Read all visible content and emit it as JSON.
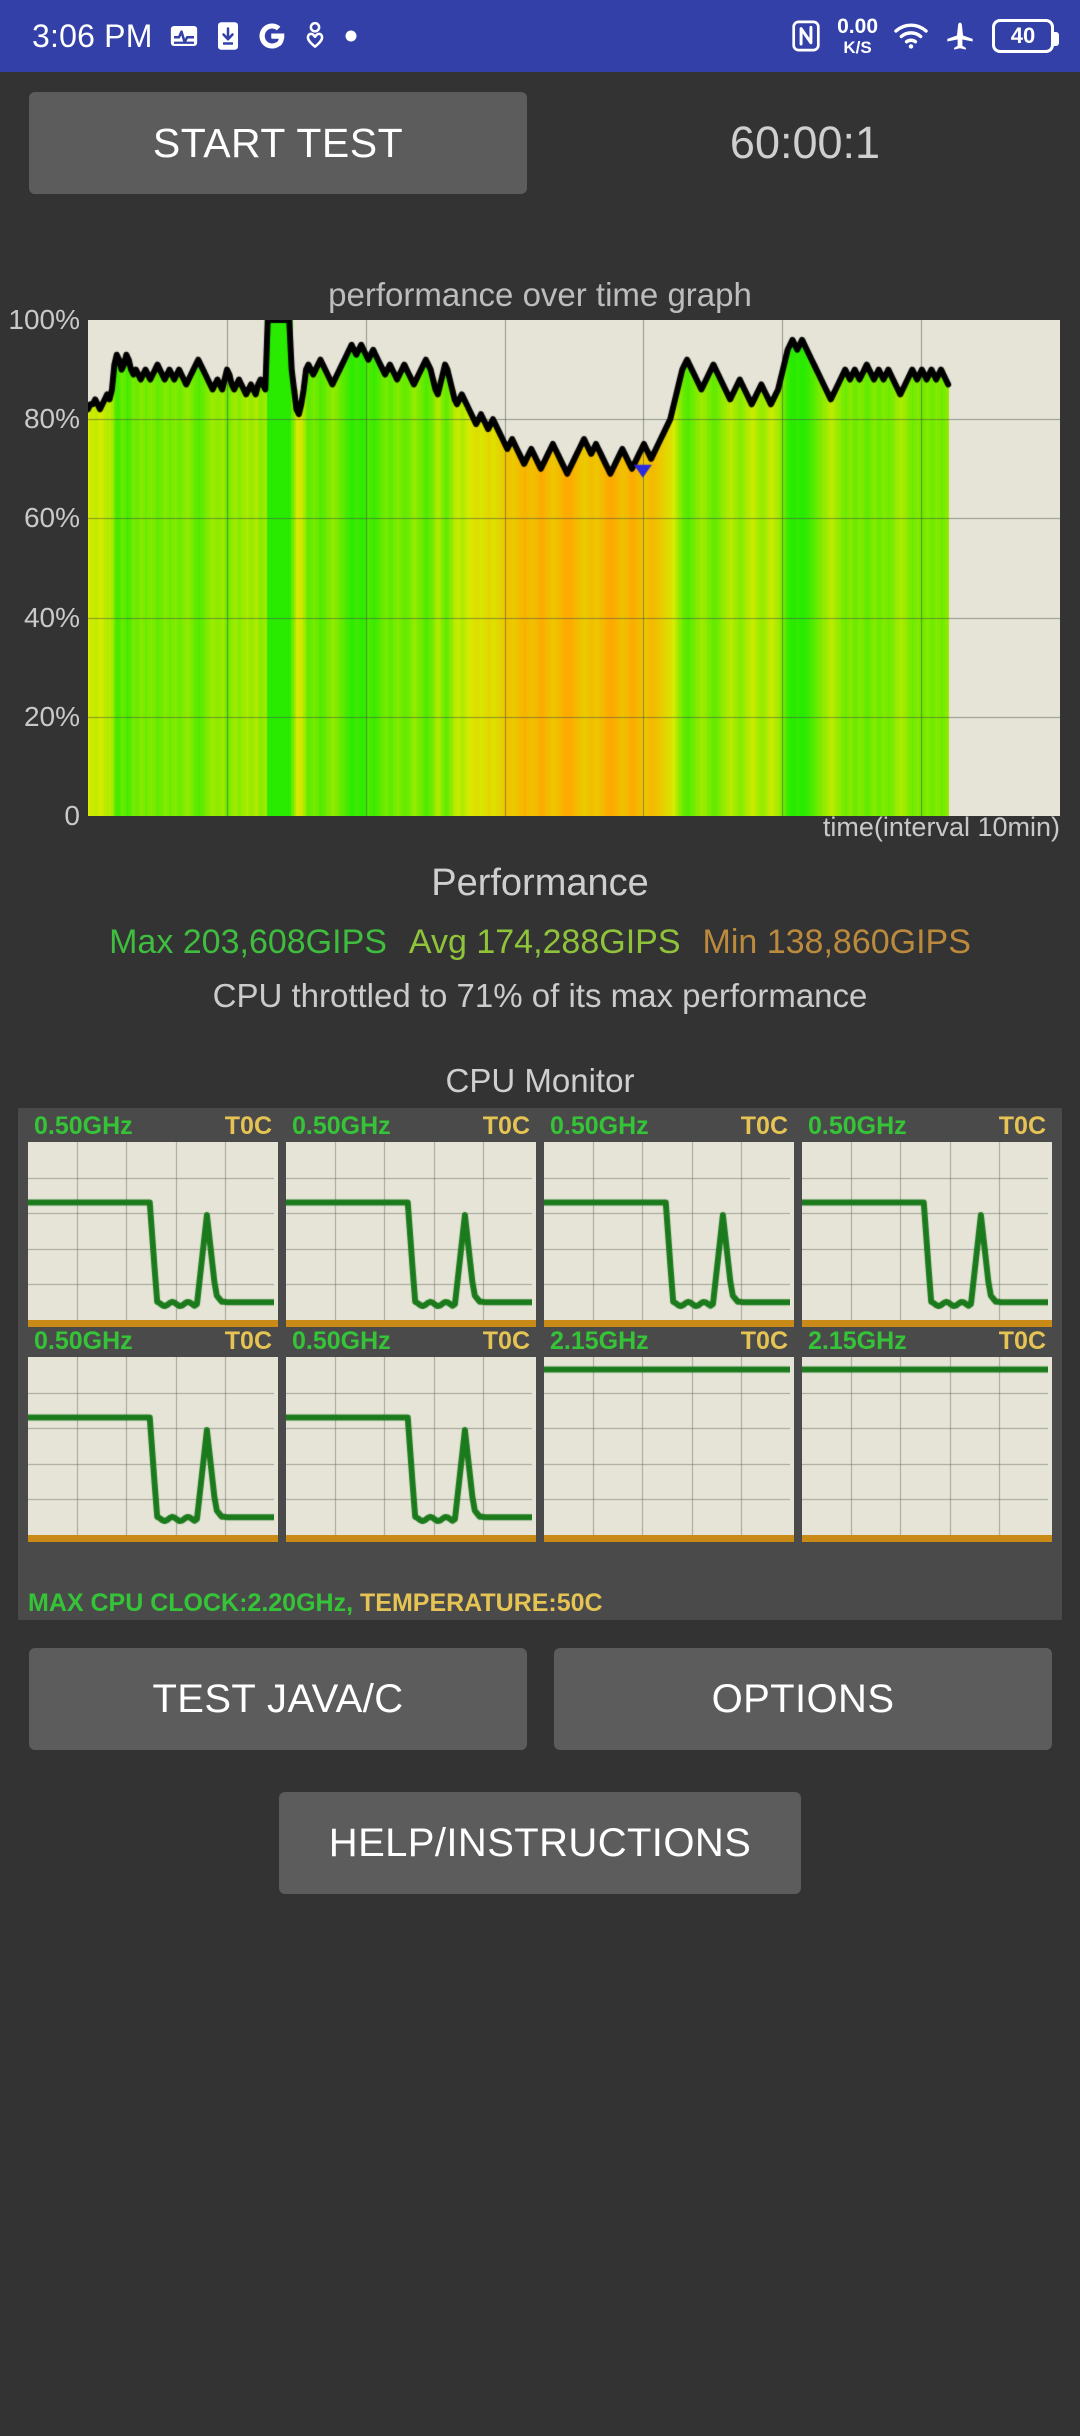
{
  "statusbar": {
    "time": "3:06 PM",
    "left_icons": [
      "activity-monitor-icon",
      "phone-download-icon",
      "google-icon",
      "person-heart-icon",
      "dot-icon"
    ],
    "network_speed_value": "0.00",
    "network_speed_unit": "K/S",
    "right_icons": [
      "nfc-icon",
      "network-speed-indicator",
      "wifi-icon",
      "airplane-mode-icon",
      "battery-icon"
    ],
    "battery_level": "40",
    "background_color": "#3340a8"
  },
  "toolbar": {
    "start_test_label": "START TEST",
    "timer": "60:00:1"
  },
  "chart_data": {
    "type": "area",
    "title": "performance over time graph",
    "xlabel": "time(interval 10min)",
    "ylabel": "",
    "ytick_labels": [
      "100%",
      "80%",
      "60%",
      "40%",
      "20%",
      "0"
    ],
    "ytick_values": [
      100,
      80,
      60,
      40,
      20,
      0
    ],
    "ylim": [
      0,
      100
    ],
    "grid": true,
    "plot_bg": "#e6e4d7",
    "line_color": "#000000",
    "xgridlines": 6,
    "data_fraction": 0.885,
    "values": [
      82,
      83,
      83,
      84,
      83,
      82,
      83,
      84,
      85,
      84,
      86,
      91,
      93,
      92,
      90,
      91,
      93,
      92,
      90,
      89,
      90,
      89,
      88,
      89,
      90,
      89,
      88,
      89,
      90,
      91,
      90,
      89,
      88,
      89,
      90,
      89,
      88,
      89,
      90,
      89,
      88,
      87,
      88,
      89,
      90,
      91,
      92,
      91,
      90,
      89,
      88,
      87,
      86,
      87,
      88,
      87,
      86,
      88,
      90,
      89,
      87,
      86,
      87,
      88,
      87,
      86,
      85,
      86,
      87,
      86,
      85,
      87,
      88,
      87,
      86,
      100,
      100,
      100,
      100,
      100,
      100,
      100,
      100,
      100,
      100,
      90,
      86,
      82,
      81,
      83,
      86,
      90,
      91,
      90,
      89,
      90,
      91,
      92,
      91,
      90,
      89,
      88,
      87,
      88,
      89,
      90,
      91,
      92,
      93,
      94,
      95,
      94,
      93,
      94,
      95,
      94,
      93,
      92,
      93,
      94,
      93,
      92,
      91,
      90,
      89,
      90,
      91,
      90,
      89,
      88,
      89,
      90,
      91,
      90,
      89,
      88,
      87,
      88,
      89,
      90,
      91,
      92,
      91,
      90,
      88,
      86,
      85,
      87,
      89,
      91,
      90,
      88,
      86,
      84,
      83,
      84,
      85,
      84,
      83,
      82,
      81,
      80,
      79,
      80,
      81,
      80,
      79,
      78,
      79,
      80,
      79,
      78,
      77,
      76,
      75,
      74,
      75,
      76,
      75,
      74,
      73,
      72,
      71,
      72,
      73,
      74,
      73,
      72,
      71,
      70,
      71,
      72,
      73,
      74,
      75,
      74,
      73,
      72,
      71,
      70,
      69,
      70,
      71,
      72,
      73,
      74,
      75,
      76,
      75,
      74,
      73,
      74,
      75,
      74,
      73,
      72,
      71,
      70,
      69,
      70,
      71,
      72,
      73,
      74,
      73,
      72,
      71,
      70,
      71,
      72,
      73,
      74,
      75,
      74,
      73,
      72,
      73,
      74,
      75,
      76,
      77,
      78,
      79,
      80,
      82,
      84,
      86,
      88,
      90,
      91,
      92,
      91,
      90,
      89,
      88,
      87,
      86,
      87,
      88,
      89,
      90,
      91,
      90,
      89,
      88,
      87,
      86,
      85,
      84,
      85,
      86,
      87,
      88,
      87,
      86,
      85,
      84,
      83,
      84,
      85,
      86,
      87,
      86,
      85,
      84,
      83,
      84,
      85,
      86,
      88,
      90,
      92,
      94,
      95,
      96,
      95,
      94,
      95,
      96,
      95,
      94,
      93,
      92,
      91,
      90,
      89,
      88,
      87,
      86,
      85,
      84,
      85,
      86,
      87,
      88,
      89,
      90,
      89,
      88,
      89,
      90,
      89,
      88,
      89,
      90,
      91,
      90,
      89,
      88,
      89,
      90,
      89,
      88,
      89,
      90,
      89,
      88,
      87,
      86,
      85,
      86,
      87,
      88,
      89,
      90,
      89,
      88,
      89,
      90,
      89,
      88,
      89,
      90,
      89,
      88,
      89,
      90,
      89,
      88,
      87
    ],
    "marker": {
      "value": 70,
      "index_fraction": 0.645,
      "color": "#2b2be0"
    }
  },
  "performance": {
    "heading": "Performance",
    "max_label": "Max 203,608GIPS",
    "avg_label": "Avg 174,288GIPS",
    "min_label": "Min 138,860GIPS",
    "max_value": "203,608",
    "avg_value": "174,288",
    "min_value": "138,860",
    "unit": "GIPS",
    "max_color": "#3fbd3f",
    "avg_color": "#8fc43a",
    "min_color": "#bb8a3c",
    "throttle_text": "CPU throttled to 71% of its max performance"
  },
  "cpu_monitor": {
    "heading": "CPU Monitor",
    "footer_clock": "MAX CPU CLOCK:2.20GHz,",
    "footer_temp": "TEMPERATURE:50C",
    "cores": [
      {
        "clock": "0.50GHz",
        "temp": "T0C",
        "shape": "drop-spike"
      },
      {
        "clock": "0.50GHz",
        "temp": "T0C",
        "shape": "drop-spike"
      },
      {
        "clock": "0.50GHz",
        "temp": "T0C",
        "shape": "drop-spike"
      },
      {
        "clock": "0.50GHz",
        "temp": "T0C",
        "shape": "drop-spike"
      },
      {
        "clock": "0.50GHz",
        "temp": "T0C",
        "shape": "drop-spike"
      },
      {
        "clock": "0.50GHz",
        "temp": "T0C",
        "shape": "drop-spike"
      },
      {
        "clock": "2.15GHz",
        "temp": "T0C",
        "shape": "flat-high"
      },
      {
        "clock": "2.15GHz",
        "temp": "T0C",
        "shape": "flat-high"
      }
    ]
  },
  "buttons": {
    "test_java_c": "TEST JAVA/C",
    "options": "OPTIONS",
    "help_instructions": "HELP/INSTRUCTIONS"
  }
}
